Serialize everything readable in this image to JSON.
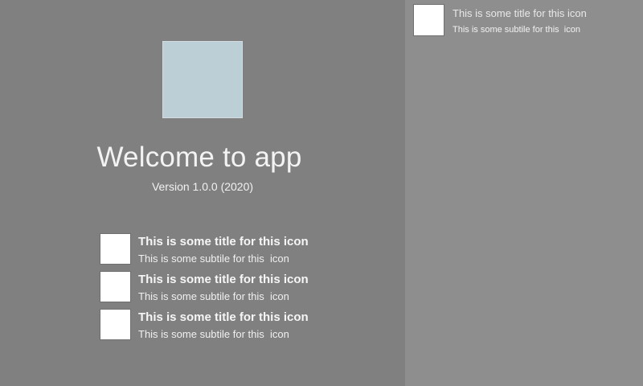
{
  "welcome": {
    "title": "Welcome to app",
    "version": "Version 1.0.0 (2020)"
  },
  "features": [
    {
      "title": "This is some title for this icon",
      "subtitle": "This is some subtile for this  icon"
    },
    {
      "title": "This is some title for this icon",
      "subtitle": "This is some subtile for this  icon"
    },
    {
      "title": "This is some title for this icon",
      "subtitle": "This is some subtile for this  icon"
    }
  ],
  "side_panel": {
    "item": {
      "title": "This is some title for this icon",
      "subtitle": "This is some subtile for this  icon"
    }
  },
  "colors": {
    "left_background": "#808080",
    "right_background": "#8e8e8e",
    "app_icon": "#bccfd6"
  }
}
